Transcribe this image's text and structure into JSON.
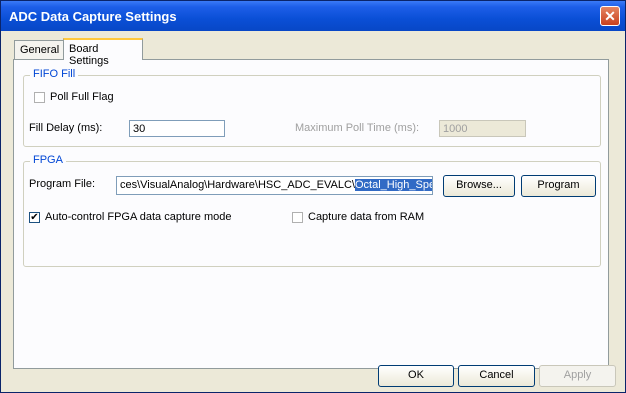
{
  "window": {
    "title": "ADC Data Capture Settings"
  },
  "tabs": [
    {
      "label": "General",
      "active": false
    },
    {
      "label": "Board Settings",
      "active": true
    }
  ],
  "fifo": {
    "legend": "FIFO Fill",
    "poll_full_flag_label": "Poll Full Flag",
    "poll_full_flag_checked": false,
    "fill_delay_label": "Fill Delay (ms):",
    "fill_delay_value": "30",
    "max_poll_label": "Maximum Poll Time (ms):",
    "max_poll_value": "1000"
  },
  "fpga": {
    "legend": "FPGA",
    "program_file_label": "Program File:",
    "program_file_value_plain": "ces\\VisualAnalog\\Hardware\\HSC_ADC_EVALC\\",
    "program_file_value_selected": "Octal_High_Speed.bir",
    "browse_label": "Browse...",
    "program_label": "Program",
    "auto_control_label": "Auto-control FPGA data capture mode",
    "auto_control_checked": true,
    "capture_ram_label": "Capture data from RAM",
    "capture_ram_checked": false
  },
  "footer": {
    "ok_label": "OK",
    "cancel_label": "Cancel",
    "apply_label": "Apply"
  },
  "icons": {
    "close": "close-icon",
    "check": "checkmark-icon"
  }
}
